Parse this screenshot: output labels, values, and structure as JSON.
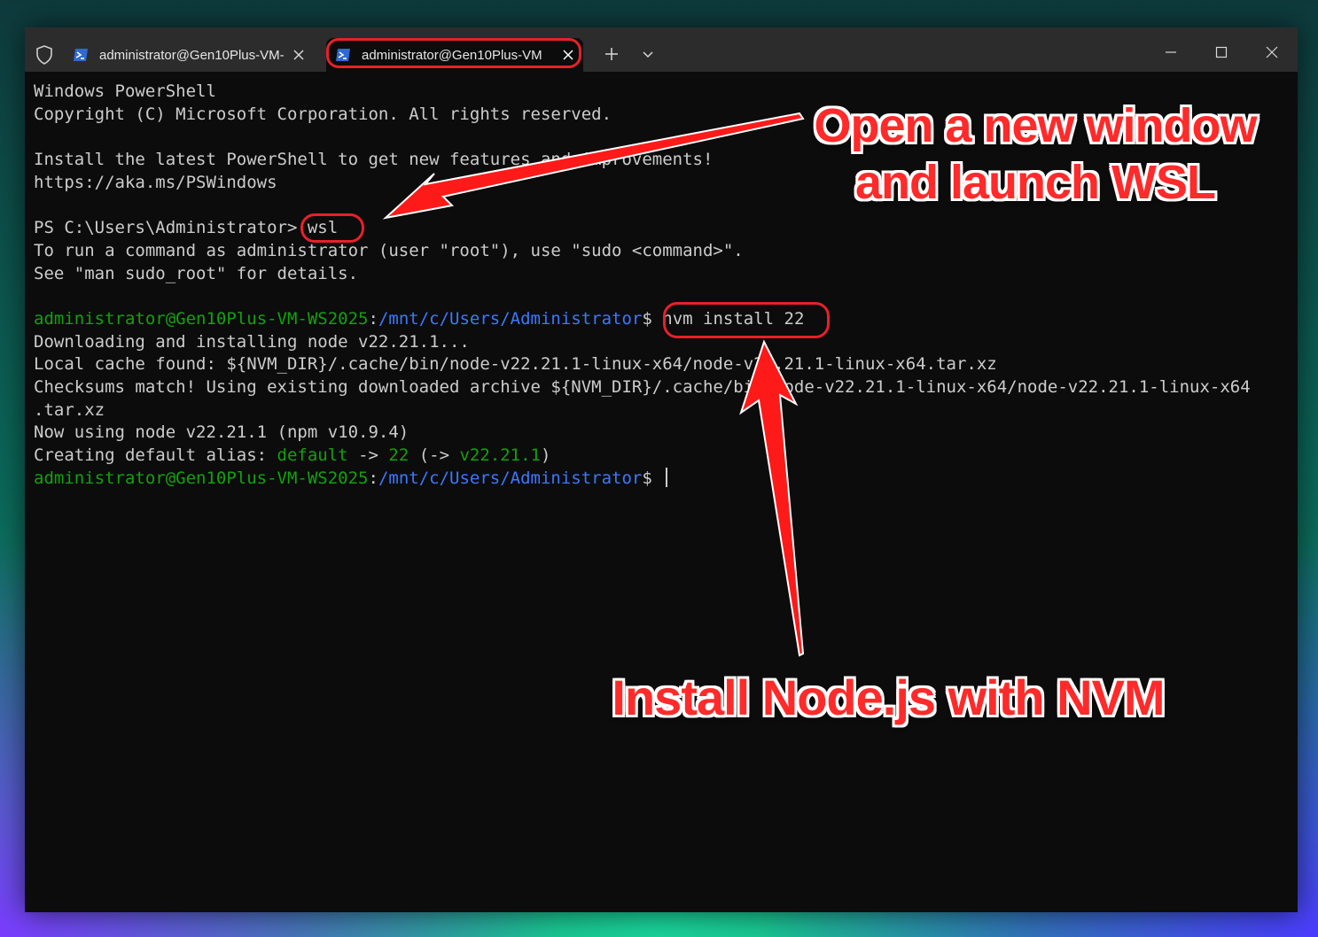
{
  "titlebar": {
    "tabs": [
      {
        "title": "administrator@Gen10Plus-VM-",
        "active": false
      },
      {
        "title": "administrator@Gen10Plus-VM",
        "active": true
      }
    ]
  },
  "terminal": {
    "lines": [
      [
        {
          "t": "Windows PowerShell",
          "c": "w"
        }
      ],
      [
        {
          "t": "Copyright (C) Microsoft Corporation. All rights reserved.",
          "c": "w"
        }
      ],
      [
        {
          "t": "",
          "c": "w"
        }
      ],
      [
        {
          "t": "Install the latest PowerShell to get new features and improvements!",
          "c": "w"
        }
      ],
      [
        {
          "t": "https://aka.ms/PSWindows",
          "c": "w"
        }
      ],
      [
        {
          "t": "",
          "c": "w"
        }
      ],
      [
        {
          "t": "PS C:\\Users\\Administrator> wsl",
          "c": "w"
        }
      ],
      [
        {
          "t": "To run a command as administrator (user \"root\"), use \"sudo <command>\".",
          "c": "w"
        }
      ],
      [
        {
          "t": "See \"man sudo_root\" for details.",
          "c": "w"
        }
      ],
      [
        {
          "t": "",
          "c": "w"
        }
      ],
      [
        {
          "t": "administrator@Gen10Plus-VM-WS2025",
          "c": "g"
        },
        {
          "t": ":",
          "c": "w"
        },
        {
          "t": "/mnt/c/Users/Administrator",
          "c": "b"
        },
        {
          "t": "$ nvm install 22",
          "c": "w"
        }
      ],
      [
        {
          "t": "Downloading and installing node v22.21.1...",
          "c": "w"
        }
      ],
      [
        {
          "t": "Local cache found: ${NVM_DIR}/.cache/bin/node-v22.21.1-linux-x64/node-v22.21.1-linux-x64.tar.xz",
          "c": "w"
        }
      ],
      [
        {
          "t": "Checksums match! Using existing downloaded archive ${NVM_DIR}/.cache/bin/node-v22.21.1-linux-x64/node-v22.21.1-linux-x64",
          "c": "w"
        }
      ],
      [
        {
          "t": ".tar.xz",
          "c": "w"
        }
      ],
      [
        {
          "t": "Now using node v22.21.1 (npm v10.9.4)",
          "c": "w"
        }
      ],
      [
        {
          "t": "Creating default alias: ",
          "c": "w"
        },
        {
          "t": "default",
          "c": "g"
        },
        {
          "t": " -> ",
          "c": "w"
        },
        {
          "t": "22",
          "c": "g"
        },
        {
          "t": " (-> ",
          "c": "w"
        },
        {
          "t": "v22.21.1",
          "c": "g"
        },
        {
          "t": ")",
          "c": "w"
        }
      ],
      [
        {
          "t": "administrator@Gen10Plus-VM-WS2025",
          "c": "g"
        },
        {
          "t": ":",
          "c": "w"
        },
        {
          "t": "/mnt/c/Users/Administrator",
          "c": "b"
        },
        {
          "t": "$ ",
          "c": "w"
        }
      ]
    ]
  },
  "annotations": {
    "callout_top": "Open a new window and launch WSL",
    "callout_bottom": "Install Node.js with NVM"
  },
  "colors": {
    "prompt_user": "#13a10e",
    "prompt_path": "#3b78ff",
    "annotation": "#ff2a2a"
  },
  "icons": [
    "shield-icon",
    "powershell-icon",
    "close-icon",
    "plus-icon",
    "chevron-down-icon",
    "minimize-icon",
    "maximize-icon",
    "close-window-icon"
  ]
}
